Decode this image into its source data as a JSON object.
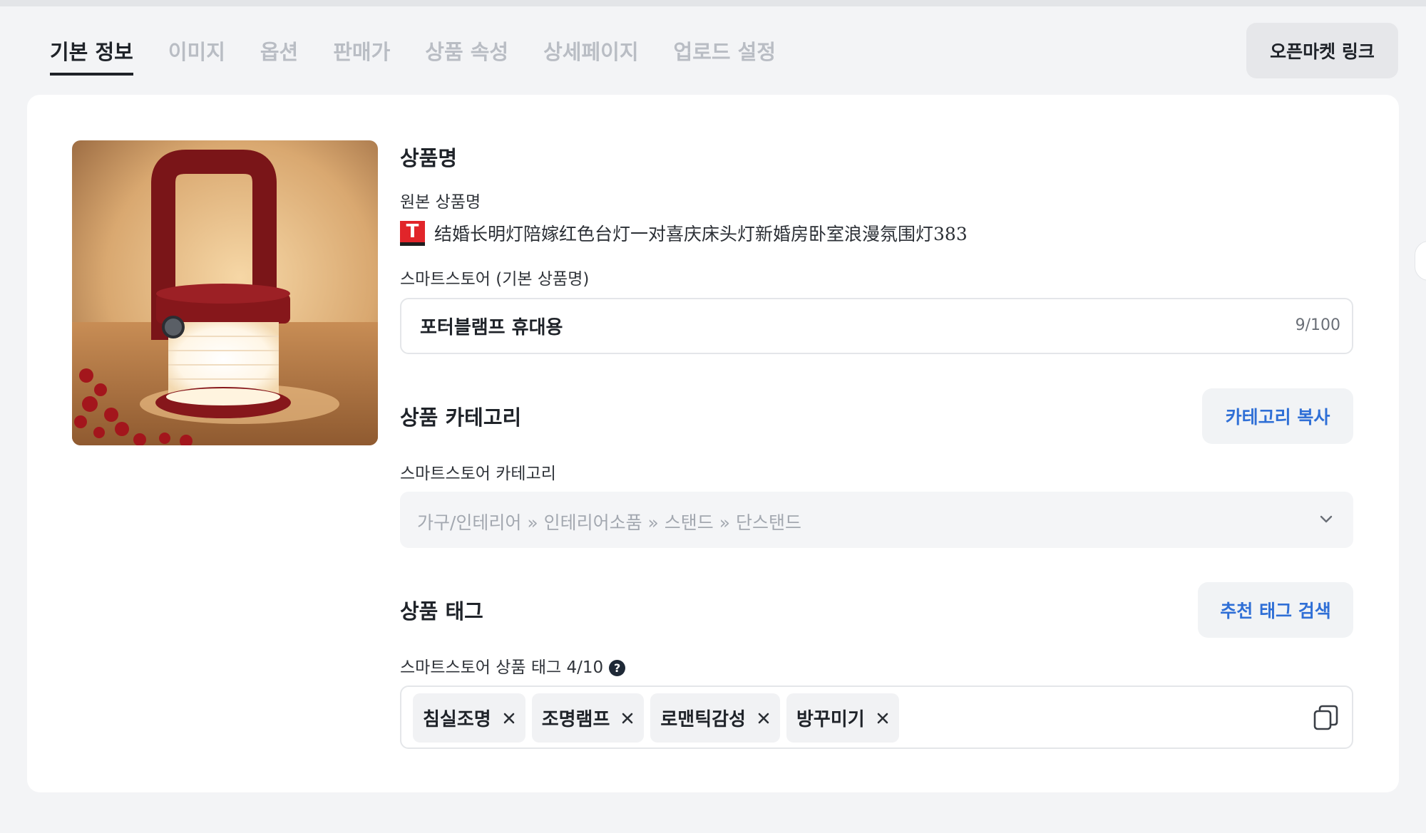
{
  "tabs": [
    {
      "label": "기본 정보",
      "active": true
    },
    {
      "label": "이미지",
      "active": false
    },
    {
      "label": "옵션",
      "active": false
    },
    {
      "label": "판매가",
      "active": false
    },
    {
      "label": "상품 속성",
      "active": false
    },
    {
      "label": "상세페이지",
      "active": false
    },
    {
      "label": "업로드 설정",
      "active": false
    }
  ],
  "header": {
    "openmarket_link_label": "오픈마켓 링크"
  },
  "product_name": {
    "title": "상품명",
    "original_label": "원본 상품명",
    "source_badge": "T",
    "original_text": "结婚长明灯陪嫁红色台灯一对喜庆床头灯新婚房卧室浪漫氛围灯383",
    "smartstore_label": "스마트스토어 (기본 상품명)",
    "value": "포터블램프 휴대용",
    "counter": "9/100"
  },
  "category": {
    "title": "상품 카테고리",
    "copy_button": "카테고리 복사",
    "smartstore_label": "스마트스토어 카테고리",
    "selected_path": "가구/인테리어 » 인테리어소품 » 스탠드 » 단스탠드"
  },
  "tags": {
    "title": "상품 태그",
    "search_button": "추천 태그 검색",
    "smartstore_label": "스마트스토어 상품 태그 4/10",
    "help": "?",
    "items": [
      "침실조명",
      "조명램프",
      "로맨틱감성",
      "방꾸미기"
    ]
  },
  "colors": {
    "accent": "#2f6fd6",
    "badge_red": "#e1252a"
  },
  "icons": {
    "help": "question-circle-icon",
    "select": "chevron-down-icon",
    "tag_remove": "close-icon",
    "copy": "copy-icon"
  }
}
